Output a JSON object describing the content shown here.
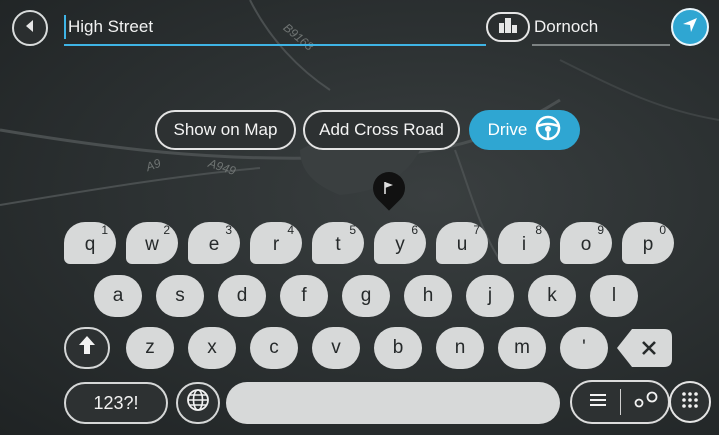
{
  "search": {
    "value": "High Street"
  },
  "city": {
    "value": "Dornoch",
    "icon": "city-icon"
  },
  "map": {
    "road_labels": [
      "B9168",
      "A9",
      "A949"
    ]
  },
  "actions": {
    "show_on_map": "Show on Map",
    "add_cross_road": "Add Cross Road",
    "drive": "Drive",
    "drive_icon": "steering-wheel-icon"
  },
  "keyboard": {
    "row1": [
      {
        "letter": "q",
        "num": "1"
      },
      {
        "letter": "w",
        "num": "2"
      },
      {
        "letter": "e",
        "num": "3"
      },
      {
        "letter": "r",
        "num": "4"
      },
      {
        "letter": "t",
        "num": "5"
      },
      {
        "letter": "y",
        "num": "6"
      },
      {
        "letter": "u",
        "num": "7"
      },
      {
        "letter": "i",
        "num": "8"
      },
      {
        "letter": "o",
        "num": "9"
      },
      {
        "letter": "p",
        "num": "0"
      }
    ],
    "row2": [
      "a",
      "s",
      "d",
      "f",
      "g",
      "h",
      "j",
      "k",
      "l"
    ],
    "row3": [
      "z",
      "x",
      "c",
      "v",
      "b",
      "n",
      "m",
      "'"
    ],
    "symbols_label": "123?!",
    "icons": [
      "shift-icon",
      "backspace-icon",
      "globe-icon",
      "list-icon",
      "route-icon",
      "keypad-icon",
      "back-arrow-icon",
      "navigation-arrow-icon",
      "flag-pin-icon"
    ]
  },
  "colors": {
    "accent": "#2fa6d2",
    "key": "#d7d9d9",
    "dark": "#2d3132"
  }
}
